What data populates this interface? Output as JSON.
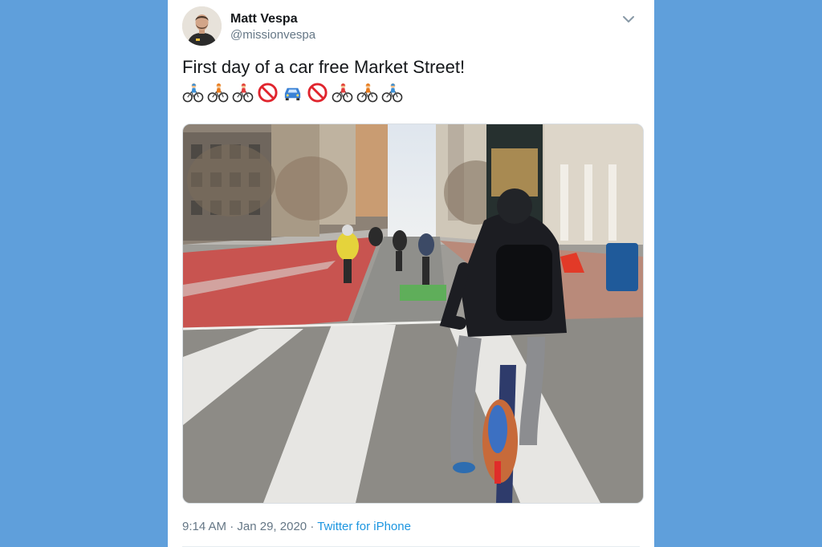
{
  "tweet": {
    "author": {
      "name": "Matt Vespa",
      "handle": "@missionvespa"
    },
    "text": "First day of a car free Market Street!",
    "emojis": [
      "man-biking-icon",
      "person-biking-icon",
      "woman-biking-icon",
      "prohibited-icon",
      "car-icon",
      "prohibited-icon",
      "woman-biking-icon",
      "person-biking-icon",
      "man-biking-icon"
    ],
    "time": "9:14 AM",
    "date": "Jan 29, 2020",
    "separator": "·",
    "source": "Twitter for iPhone"
  },
  "colors": {
    "page_background": "#5f9fdb",
    "card_background": "#ffffff",
    "link": "#1b95e0",
    "secondary_text": "#657786",
    "bike_lane": "#cf5452"
  }
}
